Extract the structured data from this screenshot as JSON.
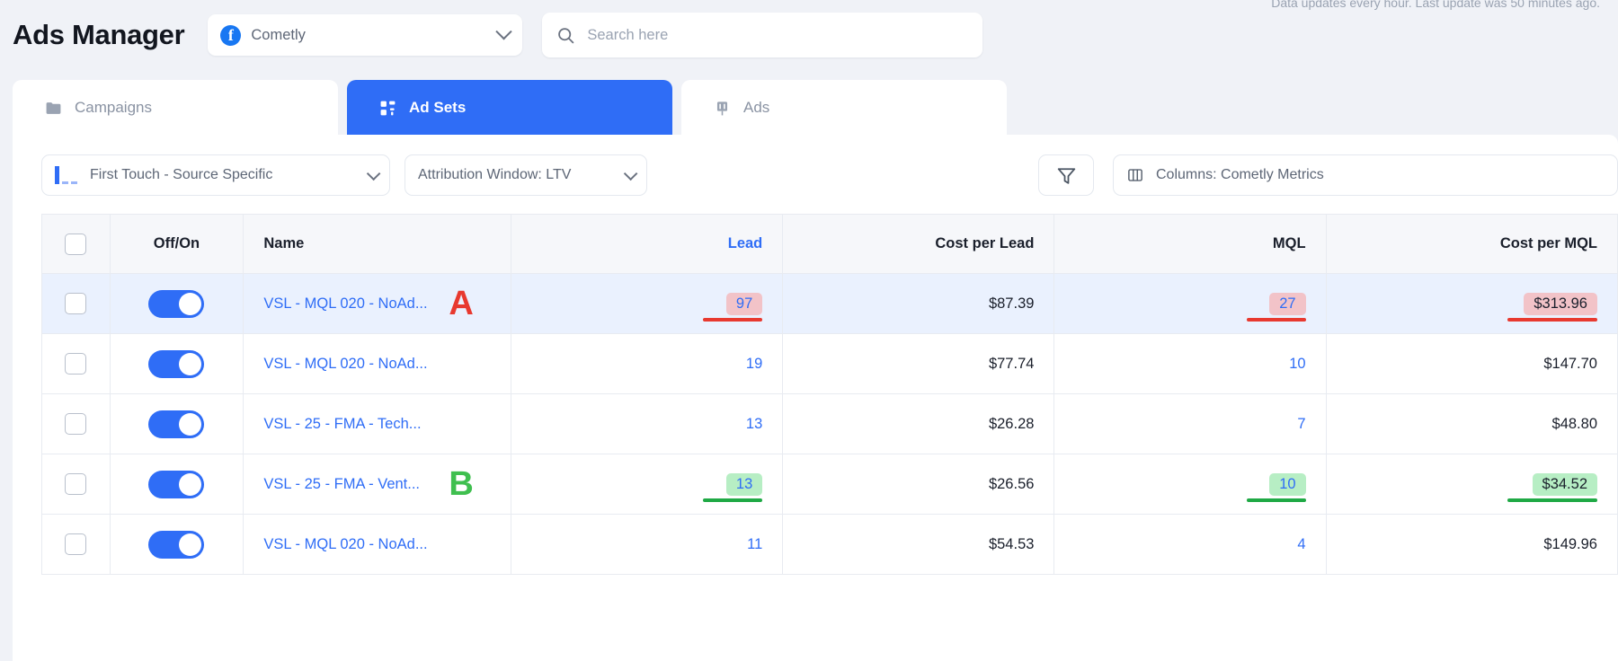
{
  "top_note": "Data updates every hour. Last update was 50 minutes ago.",
  "header": {
    "title": "Ads Manager",
    "account": {
      "name": "Cometly",
      "icon": "facebook-icon",
      "chevron": "chevron-down-icon"
    },
    "search": {
      "placeholder": "Search here",
      "value": "",
      "icon": "search-icon"
    }
  },
  "tabs": [
    {
      "label": "Campaigns",
      "icon": "folder-icon",
      "active": false
    },
    {
      "label": "Ad Sets",
      "icon": "grid-icon",
      "active": true
    },
    {
      "label": "Ads",
      "icon": "megaphone-icon",
      "active": false
    }
  ],
  "filters": {
    "attribution_model": "First Touch - Source Specific",
    "attribution_window": "Attribution Window: LTV",
    "filter_icon": "funnel-icon",
    "columns": "Columns: Cometly Metrics",
    "columns_icon": "columns-icon"
  },
  "table": {
    "columns": [
      "Off/On",
      "Name",
      "Lead",
      "Cost per Lead",
      "MQL",
      "Cost per MQL"
    ],
    "sorted_column": "Lead",
    "rows": [
      {
        "name": "VSL - MQL 020 - NoAd...",
        "lead": "97",
        "cost_per_lead": "$87.39",
        "mql": "27",
        "cost_per_mql": "$313.96",
        "toggle": "on",
        "checked": false,
        "marker": "A",
        "marker_color": "#e8392f",
        "highlight": "negative",
        "row_selected": true
      },
      {
        "name": "VSL - MQL 020 - NoAd...",
        "lead": "19",
        "cost_per_lead": "$77.74",
        "mql": "10",
        "cost_per_mql": "$147.70",
        "toggle": "on",
        "checked": false,
        "marker": "",
        "marker_color": "",
        "highlight": "none",
        "row_selected": false
      },
      {
        "name": "VSL - 25 - FMA - Tech...",
        "lead": "13",
        "cost_per_lead": "$26.28",
        "mql": "7",
        "cost_per_mql": "$48.80",
        "toggle": "on",
        "checked": false,
        "marker": "",
        "marker_color": "",
        "highlight": "none",
        "row_selected": false
      },
      {
        "name": "VSL - 25 - FMA - Vent...",
        "lead": "13",
        "cost_per_lead": "$26.56",
        "mql": "10",
        "cost_per_mql": "$34.52",
        "toggle": "on",
        "checked": false,
        "marker": "B",
        "marker_color": "#3fbf4f",
        "highlight": "positive",
        "row_selected": false
      },
      {
        "name": "VSL - MQL 020 - NoAd...",
        "lead": "11",
        "cost_per_lead": "$54.53",
        "mql": "4",
        "cost_per_mql": "$149.96",
        "toggle": "on",
        "checked": false,
        "marker": "",
        "marker_color": "",
        "highlight": "none",
        "row_selected": false
      }
    ]
  },
  "colors": {
    "accent": "#2f6df6",
    "negative": "#e8392f",
    "positive": "#3fbf4f",
    "row_selected_bg": "#eaf1fe"
  }
}
